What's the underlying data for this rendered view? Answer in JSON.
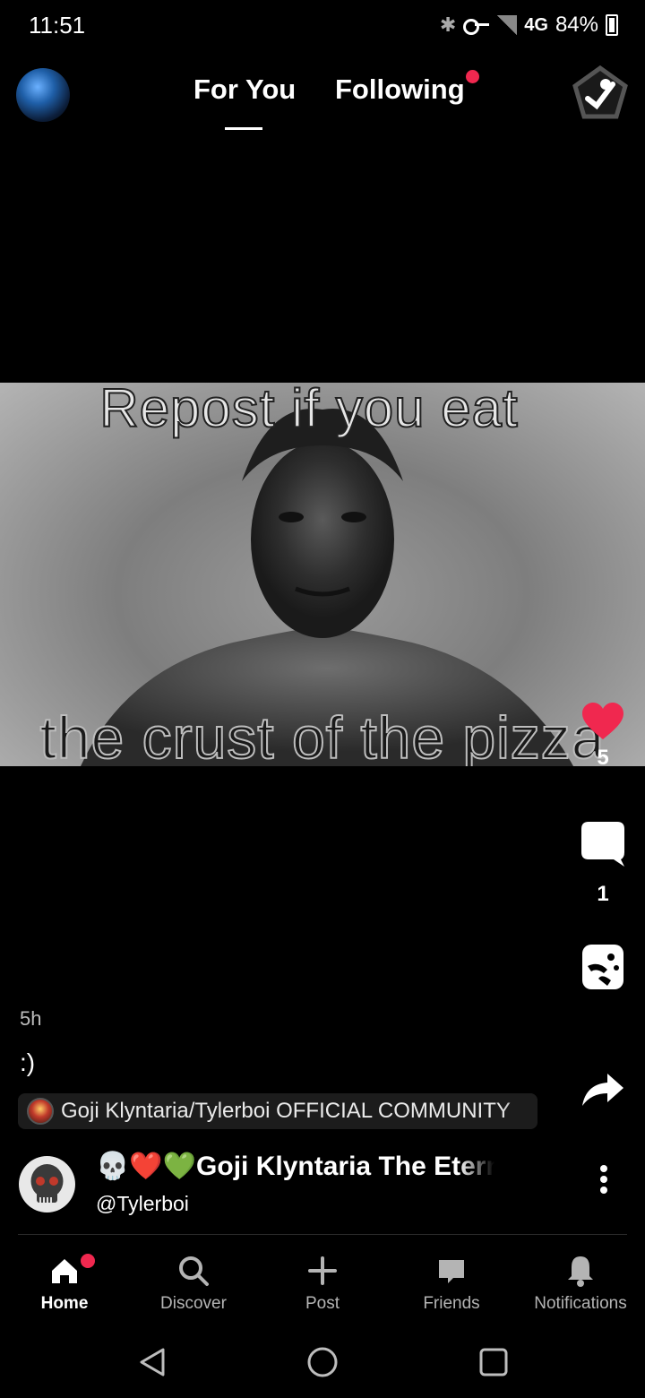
{
  "status_bar": {
    "time": "11:51",
    "network": "4G",
    "battery": "84%",
    "icons": [
      "bluetooth-icon",
      "vpn-key-icon",
      "signal-icon",
      "battery-icon"
    ]
  },
  "top_nav": {
    "tabs": [
      {
        "label": "For You",
        "active": true
      },
      {
        "label": "Following",
        "has_notification": true
      }
    ],
    "accent_color": "#f0284f"
  },
  "media": {
    "top_text": "Repost if you eat",
    "bottom_text": "the crust of the pizza"
  },
  "actions": {
    "like_count": "5",
    "comment_count": "1",
    "like_color": "#f0284f"
  },
  "post": {
    "time_ago": "5h",
    "caption": ":)",
    "community": "Goji Klyntaria/Tylerboi OFFICIAL COMMUNITY"
  },
  "author": {
    "display_name": "💀❤️💚Goji Klyntaria The Eternal",
    "handle": "@Tylerboi"
  },
  "bottom_nav": {
    "items": [
      {
        "label": "Home",
        "icon": "home-icon",
        "active": true,
        "has_notification": true
      },
      {
        "label": "Discover",
        "icon": "search-icon"
      },
      {
        "label": "Post",
        "icon": "plus-icon"
      },
      {
        "label": "Friends",
        "icon": "chat-bubble-icon"
      },
      {
        "label": "Notifications",
        "icon": "bell-icon"
      }
    ]
  }
}
